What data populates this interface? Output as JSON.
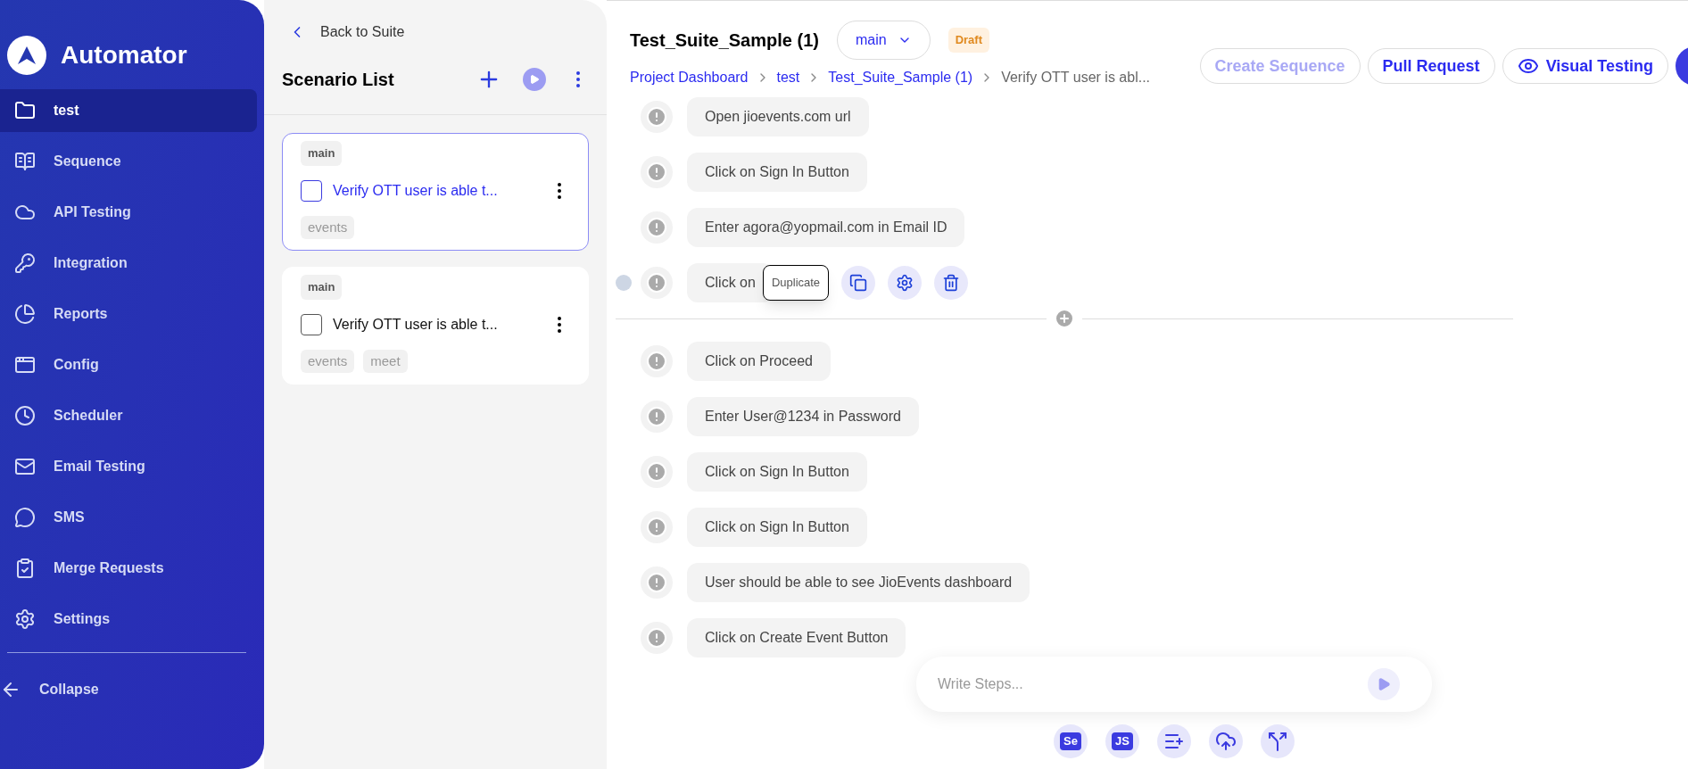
{
  "sidebar": {
    "app_name": "Automator",
    "items": [
      {
        "label": "test",
        "selected": true
      },
      {
        "label": "Sequence",
        "selected": false
      },
      {
        "label": "API Testing",
        "selected": false
      },
      {
        "label": "Integration",
        "selected": false
      },
      {
        "label": "Reports",
        "selected": false
      },
      {
        "label": "Config",
        "selected": false
      },
      {
        "label": "Scheduler",
        "selected": false
      },
      {
        "label": "Email Testing",
        "selected": false
      },
      {
        "label": "SMS",
        "selected": false
      },
      {
        "label": "Merge Requests",
        "selected": false
      },
      {
        "label": "Settings",
        "selected": false
      }
    ],
    "collapse": "Collapse"
  },
  "scenario_panel": {
    "back_link": "Back to Suite",
    "title": "Scenario List",
    "scenarios": [
      {
        "branch": "main",
        "title": "Verify OTT user is able t...",
        "checked": false,
        "selected": true,
        "tags": [
          "events"
        ]
      },
      {
        "branch": "main",
        "title": "Verify OTT user is able t...",
        "checked": false,
        "selected": false,
        "tags": [
          "events",
          "meet"
        ]
      }
    ]
  },
  "header": {
    "title": "Test_Suite_Sample (1)",
    "branch": "main",
    "status": "Draft",
    "breadcrumbs": [
      {
        "label": "Project Dashboard",
        "current": false
      },
      {
        "label": "test",
        "current": false
      },
      {
        "label": "Test_Suite_Sample (1)",
        "current": false
      },
      {
        "label": "Verify OTT user is abl...",
        "current": true
      }
    ],
    "buttons": [
      {
        "label": "Create Sequence",
        "disabled": true,
        "kind": "plain"
      },
      {
        "label": "Pull Request",
        "disabled": false,
        "kind": "plain"
      },
      {
        "label": "Visual Testing",
        "disabled": false,
        "kind": "eye"
      }
    ]
  },
  "steps": [
    {
      "text": "Open jioevents.com url",
      "hovered": false
    },
    {
      "text": "Click on Sign In Button",
      "hovered": false
    },
    {
      "text": "Enter agora@yopmail.com in Email ID",
      "hovered": false
    },
    {
      "text": "Click on",
      "hovered": true,
      "tooltip": "Duplicate"
    },
    {
      "kind": "divider"
    },
    {
      "text": "Click on Proceed",
      "hovered": false
    },
    {
      "text": "Enter User@1234 in Password",
      "hovered": false
    },
    {
      "text": "Click on Sign In Button",
      "hovered": false
    },
    {
      "text": "Click on Sign In Button",
      "hovered": false
    },
    {
      "text": "User should be able to see JioEvents dashboard",
      "hovered": false
    },
    {
      "text": "Click on Create Event Button",
      "hovered": false
    }
  ],
  "composer": {
    "placeholder": "Write Steps..."
  },
  "tools": [
    {
      "kind": "text",
      "label": "Se"
    },
    {
      "kind": "text",
      "label": "JS"
    },
    {
      "kind": "list"
    },
    {
      "kind": "cloud"
    },
    {
      "kind": "branch"
    }
  ]
}
